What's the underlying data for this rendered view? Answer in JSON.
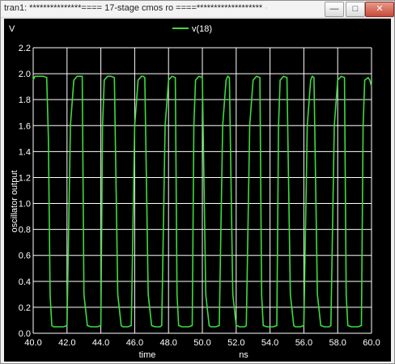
{
  "window": {
    "title": "tran1: ***************==== 17-stage cmos ro ====*******************",
    "title_faded_suffix": "· · · · · · · · · ·",
    "buttons": [
      "minimize",
      "maximize",
      "close"
    ]
  },
  "plot": {
    "unit_label": "V",
    "legend_label": "v(18)",
    "background": "#000000",
    "grid_color": "#ffffff",
    "trace_color": "#3ddc3d"
  },
  "chart_data": {
    "type": "line",
    "title": "",
    "xlabel": "time",
    "xlabel_units": "ns",
    "ylabel": "oscillator output",
    "xlim": [
      40.0,
      60.0
    ],
    "ylim": [
      0.0,
      2.2
    ],
    "x_ticks": [
      "40.0",
      "42.0",
      "44.0",
      "46.0",
      "48.0",
      "50.0",
      "52.0",
      "54.0",
      "56.0",
      "58.0",
      "60.0"
    ],
    "y_ticks": [
      "0.0",
      "0.2",
      "0.4",
      "0.6",
      "0.8",
      "1.0",
      "1.2",
      "1.4",
      "1.6",
      "1.8",
      "2.0",
      "2.2"
    ],
    "grid": true,
    "legend": "top-center",
    "series": [
      {
        "name": "v(18)",
        "x": [
          40.0,
          40.1,
          40.2,
          40.4,
          40.6,
          40.8,
          40.9,
          41.0,
          41.1,
          41.2,
          41.4,
          41.6,
          41.8,
          42.0,
          42.2,
          42.4,
          42.6,
          42.7,
          42.8,
          42.9,
          43.0,
          43.2,
          43.4,
          43.6,
          43.8,
          44.0,
          44.1,
          44.2,
          44.4,
          44.6,
          44.8,
          45.0,
          45.2,
          45.3,
          45.4,
          45.6,
          45.8,
          46.0,
          46.2,
          46.4,
          46.5,
          46.6,
          46.8,
          47.0,
          47.2,
          47.4,
          47.5,
          47.6,
          47.8,
          48.0,
          48.2,
          48.4,
          48.5,
          48.6,
          48.8,
          49.0,
          49.2,
          49.4,
          49.5,
          49.6,
          49.8,
          50.0,
          50.2,
          50.4,
          50.5,
          50.6,
          50.8,
          51.0,
          51.2,
          51.4,
          51.5,
          51.6,
          51.8,
          52.0,
          52.2,
          52.4,
          52.5,
          52.6,
          52.8,
          53.0,
          53.2,
          53.4,
          53.5,
          53.6,
          53.8,
          54.0,
          54.2,
          54.4,
          54.5,
          54.6,
          54.8,
          55.0,
          55.2,
          55.4,
          55.5,
          55.6,
          55.8,
          56.0,
          56.2,
          56.4,
          56.5,
          56.6,
          56.8,
          57.0,
          57.2,
          57.4,
          57.5,
          57.6,
          57.8,
          58.0,
          58.2,
          58.4,
          58.5,
          58.6,
          58.8,
          59.0,
          59.2,
          59.4,
          59.5,
          59.6,
          59.8,
          59.9,
          60.0
        ],
        "y": [
          1.95,
          1.98,
          1.98,
          1.98,
          1.98,
          1.97,
          1.5,
          0.3,
          0.06,
          0.05,
          0.05,
          0.05,
          0.05,
          0.06,
          1.6,
          1.95,
          1.98,
          1.98,
          1.98,
          1.98,
          0.3,
          0.06,
          0.05,
          0.05,
          0.05,
          0.06,
          1.6,
          1.95,
          1.98,
          1.98,
          1.97,
          0.3,
          0.06,
          0.05,
          0.05,
          0.05,
          0.06,
          1.6,
          1.95,
          1.98,
          1.98,
          1.97,
          0.3,
          0.06,
          0.05,
          0.05,
          0.05,
          0.06,
          1.6,
          1.95,
          1.98,
          1.97,
          0.3,
          0.06,
          0.05,
          0.05,
          0.05,
          0.06,
          1.6,
          1.95,
          1.98,
          1.97,
          0.3,
          0.06,
          0.05,
          0.05,
          0.05,
          0.06,
          1.6,
          1.95,
          1.98,
          1.97,
          0.3,
          0.06,
          0.05,
          0.05,
          0.05,
          0.06,
          1.6,
          1.95,
          1.98,
          1.97,
          0.3,
          0.06,
          0.05,
          0.05,
          0.05,
          0.06,
          1.6,
          1.95,
          1.98,
          1.97,
          0.3,
          0.06,
          0.05,
          0.05,
          0.05,
          0.06,
          1.6,
          1.95,
          1.98,
          1.97,
          0.3,
          0.06,
          0.05,
          0.05,
          0.05,
          0.06,
          1.6,
          1.95,
          1.98,
          1.97,
          0.3,
          0.06,
          0.05,
          0.05,
          0.05,
          0.06,
          1.6,
          1.95,
          1.97,
          1.95,
          1.9
        ]
      }
    ]
  }
}
